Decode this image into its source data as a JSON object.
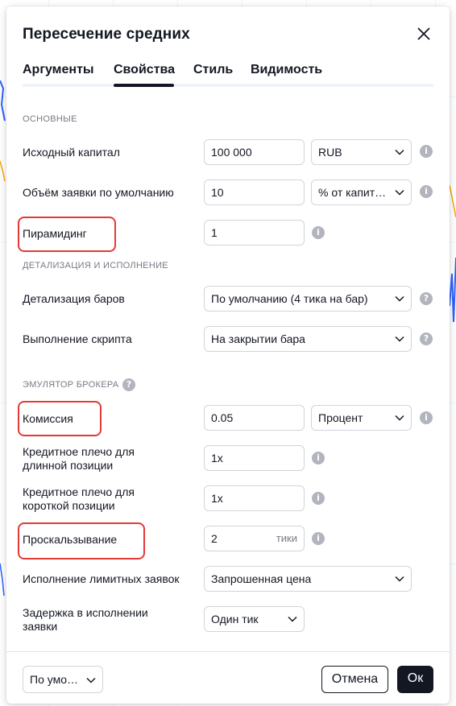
{
  "dialog": {
    "title": "Пересечение средних",
    "tabs": [
      {
        "label": "Аргументы"
      },
      {
        "label": "Свойства"
      },
      {
        "label": "Стиль"
      },
      {
        "label": "Видимость"
      }
    ],
    "active_tab": "Свойства"
  },
  "sections": {
    "basic": "ОСНОВНЫЕ",
    "detail": "ДЕТАЛИЗАЦИЯ И ИСПОЛНЕНИЕ",
    "broker": "ЭМУЛЯТОР БРОКЕРА"
  },
  "fields": {
    "initial_capital": {
      "label": "Исходный капитал",
      "value": "100 000",
      "currency": "RUB"
    },
    "order_size": {
      "label": "Объём заявки по умолчанию",
      "value": "10",
      "unit": "% от капит…"
    },
    "pyramiding": {
      "label": "Пирамидинг",
      "value": "1"
    },
    "bar_detail": {
      "label": "Детализация баров",
      "value": "По умолчанию (4 тика на бар)"
    },
    "script_exec": {
      "label": "Выполнение скрипта",
      "value": "На закрытии бара"
    },
    "commission": {
      "label": "Комиссия",
      "value": "0.05",
      "unit": "Процент"
    },
    "long_leverage": {
      "label": "Кредитное плечо для длинной позиции",
      "label_line1": "Кредитное плечо для",
      "label_line2": "длинной позиции",
      "value": "1x"
    },
    "short_leverage": {
      "label": "Кредитное плечо для короткой позиции",
      "label_line1": "Кредитное плечо для",
      "label_line2": "короткой позиции",
      "value": "1x"
    },
    "slippage": {
      "label": "Проскальзывание",
      "value": "2",
      "suffix": "тики"
    },
    "limit_exec": {
      "label": "Исполнение лимитных заявок",
      "value": "Запрошенная цена"
    },
    "order_delay": {
      "label": "Задержка в исполнении заявки",
      "label_line1": "Задержка в исполнении",
      "label_line2": "заявки",
      "value": "Один тик"
    }
  },
  "footer": {
    "defaults": "По умо…",
    "cancel": "Отмена",
    "ok": "Ок"
  },
  "icons": {
    "info": "i",
    "help": "?"
  },
  "colors": {
    "highlight": "#e53935",
    "primary_button": "#131722",
    "info_icon": "#b2b5be"
  }
}
